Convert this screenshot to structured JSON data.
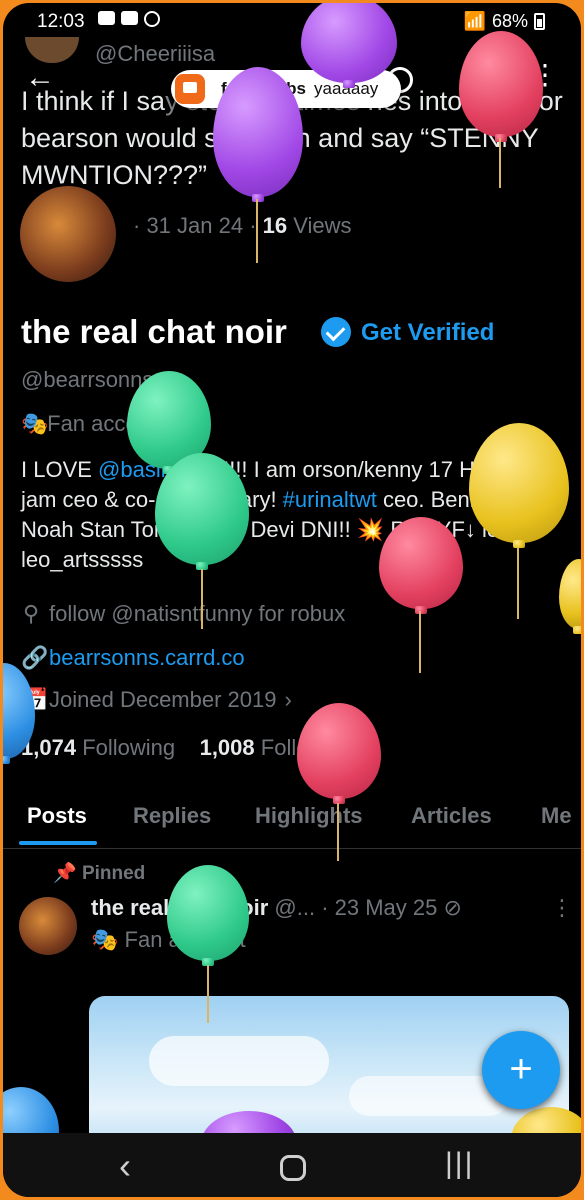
{
  "status_bar": {
    "time": "12:03",
    "battery": "68%"
  },
  "notification": {
    "user": "faggyhabs",
    "message": "yaaaaay"
  },
  "quoted_post": {
    "handle": "@Cheeriiisa",
    "text_part1": "I think if I sa",
    "text_ghost": "y stenny 3 times ",
    "text_part2": "nes into a mirror bearson would spawn in and say “STENNY MWNTION???”",
    "date": "· 31 Jan 24 ·",
    "views_count": "16",
    "views_label": "Views"
  },
  "profile": {
    "name": "the real chat noir",
    "get_verified": "Get Verified",
    "handle": "@bearrsonns",
    "category": "Fan account",
    "bio": {
      "part1": "I LOVE ",
      "mention": "@bas​il_lico",
      "part2": " !!!!! I am orson/kenny 17 HE/IT🍉 jam ceo & co-ceo of thary! ",
      "hashtag": "#urinaltwt",
      "part3": " ceo. Benny Habs Noah Stan Tommy and Devi DNI!! 💥 RCBYF↓ ic leo_artsssss"
    },
    "location": "follow @natisntfunny for robux",
    "website": "bearrsonns.carrd.co",
    "joined": "Joined December 2019",
    "following_count": "1,074",
    "following_label": "Following",
    "followers_count": "1,008",
    "followers_label": "Followers"
  },
  "tabs": [
    "Posts",
    "Replies",
    "Highlights",
    "Articles",
    "Me"
  ],
  "pinned_post": {
    "pinned_label": "Pinned",
    "name": "the real chat noir",
    "handle": "@...",
    "date": "· 23 May 25",
    "category": "Fan account"
  },
  "fab_label": "+",
  "colors": {
    "accent": "#1d9bf0",
    "frame": "#f28a1e",
    "background": "#000000"
  }
}
